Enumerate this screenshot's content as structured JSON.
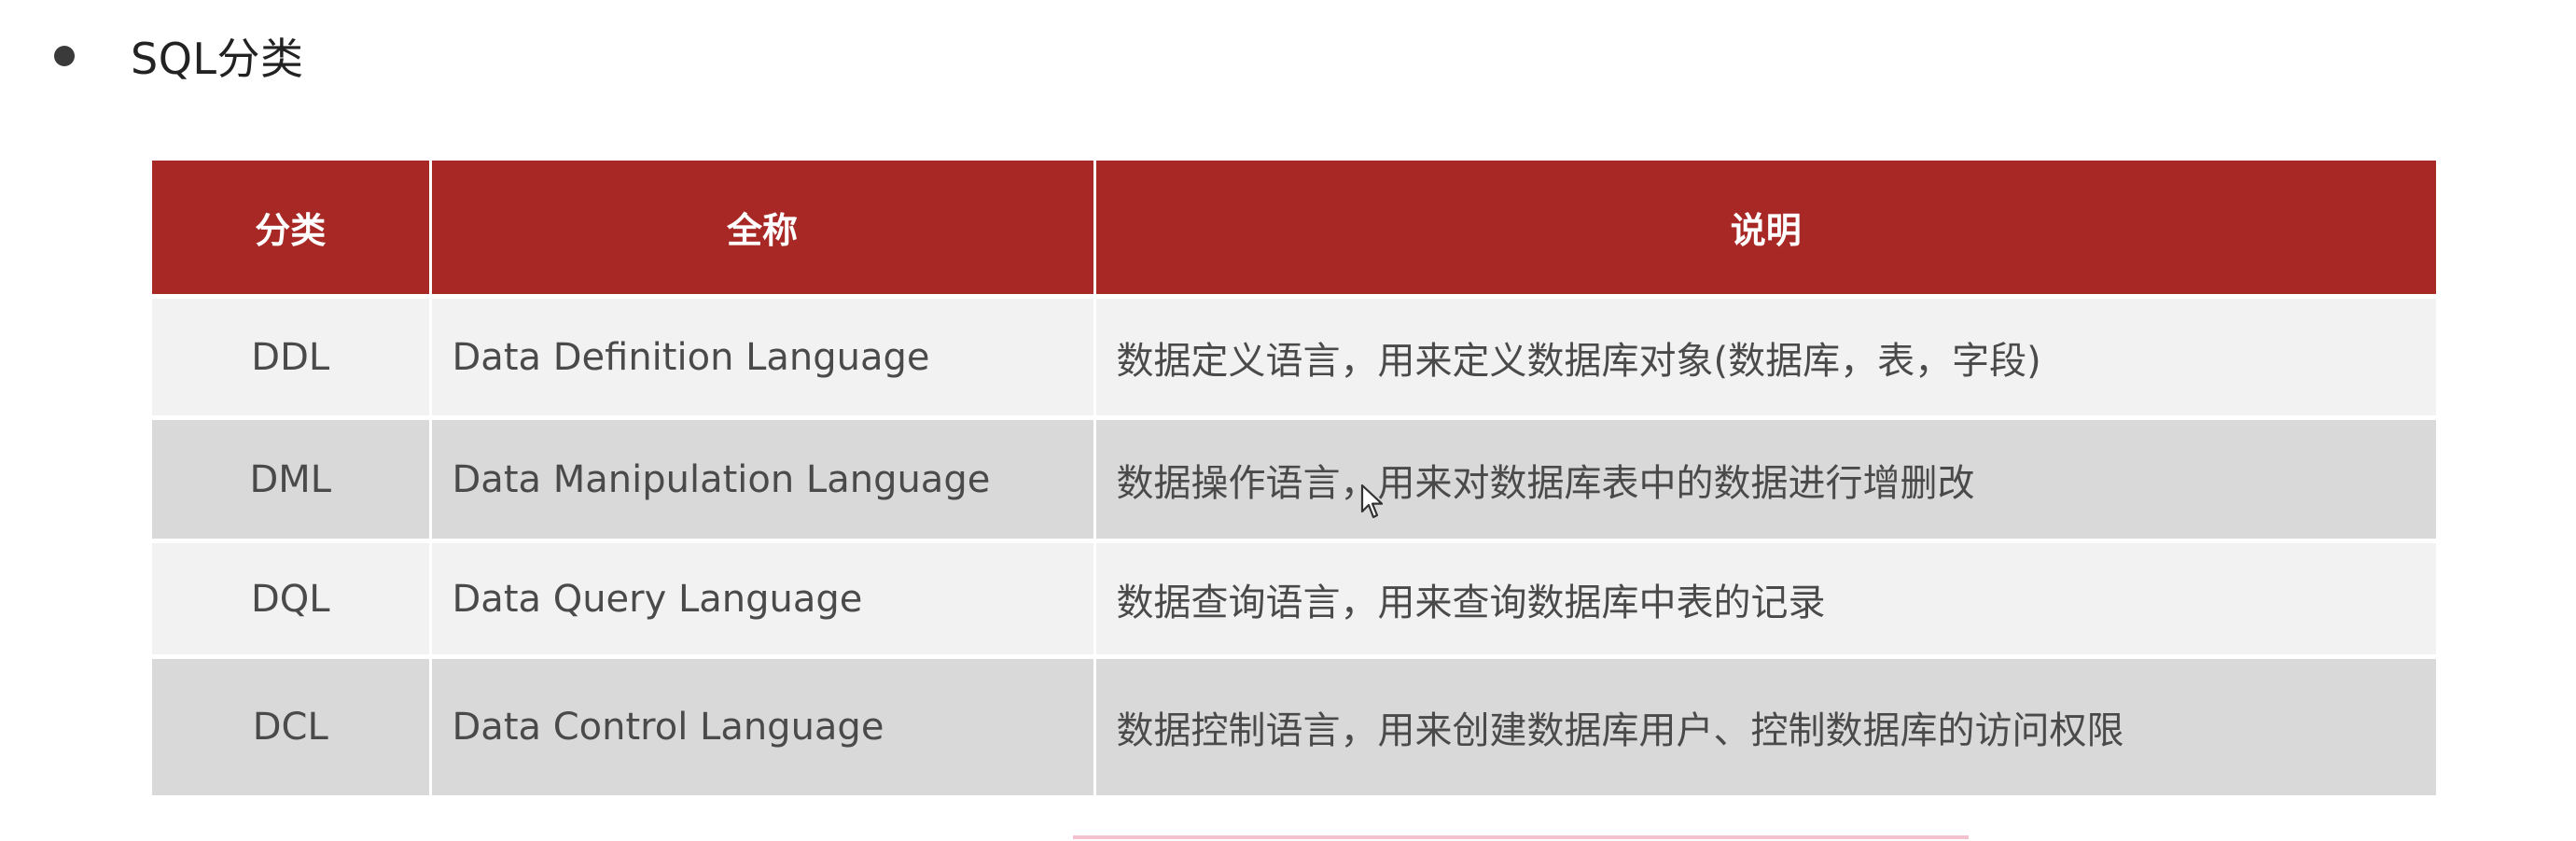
{
  "heading": {
    "text": "SQL分类"
  },
  "table": {
    "headers": [
      "分类",
      "全称",
      "说明"
    ],
    "rows": [
      {
        "category": "DDL",
        "full_name": "Data Definition Language",
        "description": "数据定义语言，用来定义数据库对象(数据库，表，字段)"
      },
      {
        "category": "DML",
        "full_name": "Data Manipulation Language",
        "description": "数据操作语言，用来对数据库表中的数据进行增删改"
      },
      {
        "category": "DQL",
        "full_name": "Data Query Language",
        "description": "数据查询语言，用来查询数据库中表的记录"
      },
      {
        "category": "DCL",
        "full_name": "Data Control Language",
        "description": "数据控制语言，用来创建数据库用户、控制数据库的访问权限"
      }
    ]
  },
  "colors": {
    "header_bg": "#a82826",
    "row_light": "#f2f2f2",
    "row_dark": "#d9d9d9"
  },
  "icons": {
    "bullet": "bullet-dot-icon",
    "cursor": "mouse-pointer-icon"
  }
}
